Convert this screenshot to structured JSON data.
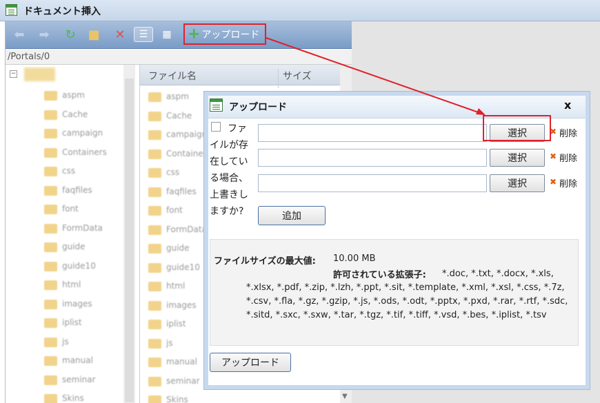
{
  "window": {
    "title": "ドキュメント挿入",
    "icon": "document-window-icon"
  },
  "toolbar": {
    "buttons": [
      {
        "name": "back-icon",
        "glyph": "⬅"
      },
      {
        "name": "forward-icon",
        "glyph": "➡"
      },
      {
        "name": "refresh-icon",
        "glyph": "↻"
      },
      {
        "name": "new-folder-icon",
        "glyph": "📁"
      },
      {
        "name": "delete-icon",
        "glyph": "✕"
      },
      {
        "name": "list-view-icon",
        "glyph": "☰"
      },
      {
        "name": "grid-view-icon",
        "glyph": "▦"
      }
    ],
    "upload_label": "アップロード"
  },
  "path": "/Portals/0",
  "tree": {
    "items": [
      "aspm",
      "Cache",
      "campaign",
      "Containers",
      "css",
      "faqfiles",
      "font",
      "FormData",
      "guide",
      "guide10",
      "html",
      "images",
      "iplist",
      "js",
      "manual",
      "seminar",
      "Skins"
    ]
  },
  "filelist": {
    "col_name": "ファイル名",
    "col_size": "サイズ",
    "items": [
      "aspm",
      "Cache",
      "campaign",
      "Containers",
      "css",
      "faqfiles",
      "font",
      "FormData",
      "guide",
      "guide10",
      "html",
      "images",
      "iplist",
      "js",
      "manual",
      "seminar",
      "Skins"
    ]
  },
  "dialog": {
    "title": "アップロード",
    "close": "x",
    "overwrite_label": "ファイルが存在している場合、上書きしますか?",
    "rows": [
      {
        "value": "",
        "select_label": "選択",
        "delete_label": "削除"
      },
      {
        "value": "",
        "select_label": "選択",
        "delete_label": "削除"
      },
      {
        "value": "",
        "select_label": "選択",
        "delete_label": "削除"
      }
    ],
    "add_label": "追加",
    "max_size_label": "ファイルサイズの最大値:",
    "max_size_value": "10.00 MB",
    "ext_label": "許可されている拡張子:",
    "ext_value": "*.doc, *.txt, *.docx, *.xls, *.xlsx, *.pdf, *.zip, *.lzh, *.ppt, *.sit, *.template, *.xml, *.xsl, *.css, *.7z, *.csv, *.fla, *.gz, *.gzip, *.js, *.ods, *.odt, *.pptx, *.pxd, *.rar, *.rtf, *.sdc, *.sitd, *.sxc, *.sxw, *.tar, *.tgz, *.tif, *.tiff, *.vsd, *.bes, *.iplist, *.tsv",
    "upload_label": "アップロード"
  },
  "colors": {
    "highlight": "#e0202a",
    "toolbar": "#7a9cc6",
    "dialog_border": "#c7d9ee"
  }
}
